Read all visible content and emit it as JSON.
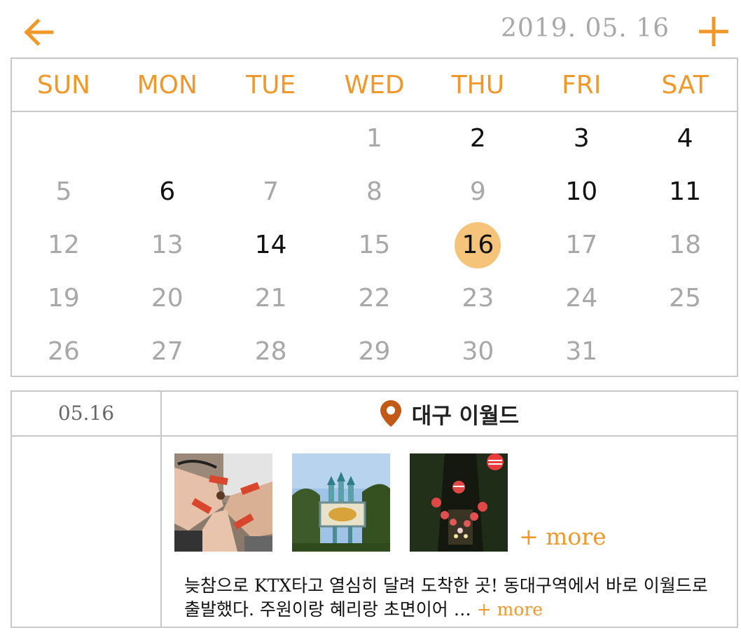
{
  "header": {
    "back_icon": "arrow-left-icon",
    "date": "2019. 05. 16",
    "add_icon": "plus-icon",
    "accent_color": "#f0982a"
  },
  "calendar": {
    "weekdays": [
      "SUN",
      "MON",
      "TUE",
      "WED",
      "THU",
      "FRI",
      "SAT"
    ],
    "weeks": [
      [
        {
          "day": "",
          "has_entry": false
        },
        {
          "day": "",
          "has_entry": false
        },
        {
          "day": "",
          "has_entry": false
        },
        {
          "day": "1",
          "has_entry": false
        },
        {
          "day": "2",
          "has_entry": true
        },
        {
          "day": "3",
          "has_entry": true
        },
        {
          "day": "4",
          "has_entry": true
        }
      ],
      [
        {
          "day": "5",
          "has_entry": false
        },
        {
          "day": "6",
          "has_entry": true
        },
        {
          "day": "7",
          "has_entry": false
        },
        {
          "day": "8",
          "has_entry": false
        },
        {
          "day": "9",
          "has_entry": false
        },
        {
          "day": "10",
          "has_entry": true
        },
        {
          "day": "11",
          "has_entry": true
        }
      ],
      [
        {
          "day": "12",
          "has_entry": false
        },
        {
          "day": "13",
          "has_entry": false
        },
        {
          "day": "14",
          "has_entry": true
        },
        {
          "day": "15",
          "has_entry": false
        },
        {
          "day": "16",
          "has_entry": true,
          "selected": true
        },
        {
          "day": "17",
          "has_entry": false
        },
        {
          "day": "18",
          "has_entry": false
        }
      ],
      [
        {
          "day": "19",
          "has_entry": false
        },
        {
          "day": "20",
          "has_entry": false
        },
        {
          "day": "21",
          "has_entry": false
        },
        {
          "day": "22",
          "has_entry": false
        },
        {
          "day": "23",
          "has_entry": false
        },
        {
          "day": "24",
          "has_entry": false
        },
        {
          "day": "25",
          "has_entry": false
        }
      ],
      [
        {
          "day": "26",
          "has_entry": false
        },
        {
          "day": "27",
          "has_entry": false
        },
        {
          "day": "28",
          "has_entry": false
        },
        {
          "day": "29",
          "has_entry": false
        },
        {
          "day": "30",
          "has_entry": false
        },
        {
          "day": "31",
          "has_entry": false
        },
        {
          "day": "",
          "has_entry": false
        }
      ]
    ],
    "selected_color": "#f5c47a"
  },
  "entry": {
    "date": "05.16",
    "location_icon": "location-pin-icon",
    "place": "대구 이월드",
    "photos": [
      "wristbands-photo",
      "castle-gate-photo",
      "lantern-night-photo"
    ],
    "photos_more": "+ more",
    "memo": "늦참으로 KTX타고 열심히 달려 도착한 곳! 동대구역에서 바로 이월드로 출발했다. 주원이랑 혜리랑 초면이어 … ",
    "memo_more": "+ more"
  }
}
